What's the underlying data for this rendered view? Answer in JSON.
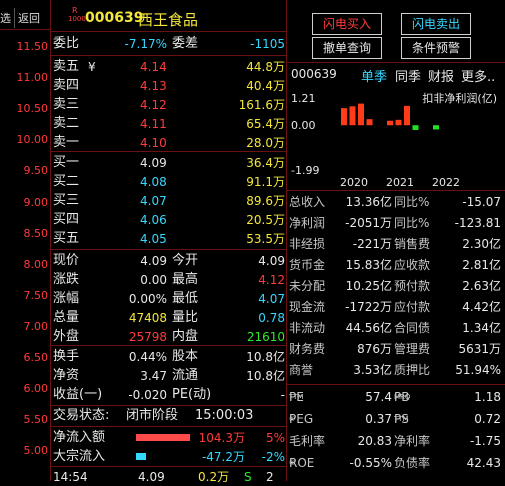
{
  "left_axis": {
    "labels": [
      "选",
      "返回",
      "11.50",
      "11.00",
      "10.50",
      "10.00",
      "9.50",
      "9.00",
      "8.50",
      "8.00",
      "7.50",
      "7.00",
      "6.50",
      "6.00",
      "5.50",
      "5.00"
    ]
  },
  "header": {
    "badge_top": "R",
    "badge_bottom": "1000",
    "code": "000639",
    "name": "西王食品"
  },
  "summary": {
    "ratio_label": "委比",
    "ratio_value": "-7.17%",
    "diff_label": "委差",
    "diff_value": "-1105"
  },
  "sell": [
    {
      "label": "卖五",
      "mark": "¥",
      "price": "4.14",
      "vol": "44.8万"
    },
    {
      "label": "卖四",
      "mark": "",
      "price": "4.13",
      "vol": "40.4万"
    },
    {
      "label": "卖三",
      "mark": "",
      "price": "4.12",
      "vol": "161.6万"
    },
    {
      "label": "卖二",
      "mark": "",
      "price": "4.11",
      "vol": "65.4万"
    },
    {
      "label": "卖一",
      "mark": "",
      "price": "4.10",
      "vol": "28.0万"
    }
  ],
  "buy": [
    {
      "label": "买一",
      "price": "4.09",
      "vol": "36.4万"
    },
    {
      "label": "买二",
      "price": "4.08",
      "vol": "91.1万"
    },
    {
      "label": "买三",
      "price": "4.07",
      "vol": "89.6万"
    },
    {
      "label": "买四",
      "price": "4.06",
      "vol": "20.5万"
    },
    {
      "label": "买五",
      "price": "4.05",
      "vol": "53.5万"
    }
  ],
  "quote": [
    {
      "l1": "现价",
      "v1": "4.09",
      "c1": "white",
      "l2": "今开",
      "v2": "4.09",
      "c2": "white"
    },
    {
      "l1": "涨跌",
      "v1": "0.00",
      "c1": "white",
      "l2": "最高",
      "v2": "4.12",
      "c2": "red"
    },
    {
      "l1": "涨幅",
      "v1": "0.00%",
      "c1": "white",
      "l2": "最低",
      "v2": "4.07",
      "c2": "cyan"
    },
    {
      "l1": "总量",
      "v1": "47408",
      "c1": "yellow",
      "l2": "量比",
      "v2": "0.78",
      "c2": "cyan"
    },
    {
      "l1": "外盘",
      "v1": "25798",
      "c1": "red",
      "l2": "内盘",
      "v2": "21610",
      "c2": "green"
    }
  ],
  "stats": [
    {
      "l1": "换手",
      "v1": "0.44%",
      "l2": "股本",
      "v2": "10.8亿"
    },
    {
      "l1": "净资",
      "v1": "3.47",
      "l2": "流通",
      "v2": "10.8亿"
    },
    {
      "l1": "收益(一)",
      "v1": "-0.020",
      "l2": "PE(动)",
      "v2": "-"
    }
  ],
  "trade_status": {
    "label": "交易状态:",
    "value": "闭市阶段",
    "time": "15:00:03"
  },
  "flows": [
    {
      "label": "净流入额",
      "value": "104.3万",
      "pct": "5%",
      "color": "#ff4a4a",
      "fill": 0.68
    },
    {
      "label": "大宗流入",
      "value": "-47.2万",
      "pct": "-2%",
      "color": "#35d8ff",
      "fill": 0.12
    }
  ],
  "bottom_partial": {
    "time": "14:54",
    "price": "4.09",
    "vol": "0.2万",
    "flag": "S",
    "num": "2"
  },
  "buttons": {
    "flash_buy": "闪电买入",
    "flash_sell": "闪电卖出",
    "cancel_query": "撤单查询",
    "condition_alert": "条件预警"
  },
  "fin_tabs": {
    "code": "000639",
    "t1": "单季",
    "t2": "同季",
    "t3": "财报",
    "t4": "更多.."
  },
  "fin_chart": {
    "type": "bar",
    "ylabels": [
      "1.21",
      "0.00",
      "-1.99"
    ],
    "ymax": 1.21,
    "ymin": -1.99,
    "legend": "扣非净利润(亿)",
    "years": [
      "2020",
      "2021",
      "2022"
    ],
    "bars": [
      {
        "year": "2020",
        "q": 1,
        "value": 0.76
      },
      {
        "year": "2020",
        "q": 2,
        "value": 0.84
      },
      {
        "year": "2020",
        "q": 3,
        "value": 0.96
      },
      {
        "year": "2020",
        "q": 4,
        "value": 0.27
      },
      {
        "year": "2021",
        "q": 1,
        "value": 0.2
      },
      {
        "year": "2021",
        "q": 2,
        "value": 0.24
      },
      {
        "year": "2021",
        "q": 3,
        "value": 0.86
      },
      {
        "year": "2021",
        "q": 4,
        "value": -0.21
      },
      {
        "year": "2022",
        "q": 1,
        "value": -0.19
      }
    ],
    "pos_color": "#ff3b1a",
    "neg_color": "#22e022"
  },
  "fin_rows": [
    {
      "l1": "总收入",
      "v1": "13.36亿",
      "l2": "同比%",
      "v2": "-15.07"
    },
    {
      "l1": "净利润",
      "v1": "-2051万",
      "l2": "同比%",
      "v2": "-123.81"
    },
    {
      "l1": "非经损",
      "v1": "-221万",
      "l2": "销售费",
      "v2": "2.30亿"
    },
    {
      "l1": "货币金",
      "v1": "15.83亿",
      "l2": "应收款",
      "v2": "2.81亿"
    },
    {
      "l1": "未分配",
      "v1": "10.25亿",
      "l2": "预付款",
      "v2": "2.63亿"
    },
    {
      "l1": "现金流",
      "v1": "-1722万",
      "l2": "应付款",
      "v2": "4.42亿"
    },
    {
      "l1": "非流动",
      "v1": "44.56亿",
      "l2": "合同债",
      "v2": "1.34亿"
    },
    {
      "l1": "财务费",
      "v1": "876万",
      "l2": "管理费",
      "v2": "5631万"
    },
    {
      "l1": "商誉",
      "v1": "3.53亿",
      "l2": "质押比",
      "v2": "51.94%"
    }
  ],
  "valuation": [
    {
      "l1": "PE",
      "s1": "TTM",
      "v1": "57.4",
      "l2": "PB",
      "s2": "MRQ",
      "v2": "1.18"
    },
    {
      "l1": "PEG",
      "s1": "①",
      "v1": "0.37",
      "l2": "PS",
      "s2": "TTM",
      "v2": "0.72"
    },
    {
      "l1": "毛利率",
      "s1": "",
      "v1": "20.83",
      "l2": "净利率",
      "s2": "",
      "v2": "-1.75"
    },
    {
      "l1": "ROE",
      "s1": "①",
      "v1": "-0.55%",
      "l2": "负债率",
      "s2": "",
      "v2": "42.43"
    }
  ]
}
